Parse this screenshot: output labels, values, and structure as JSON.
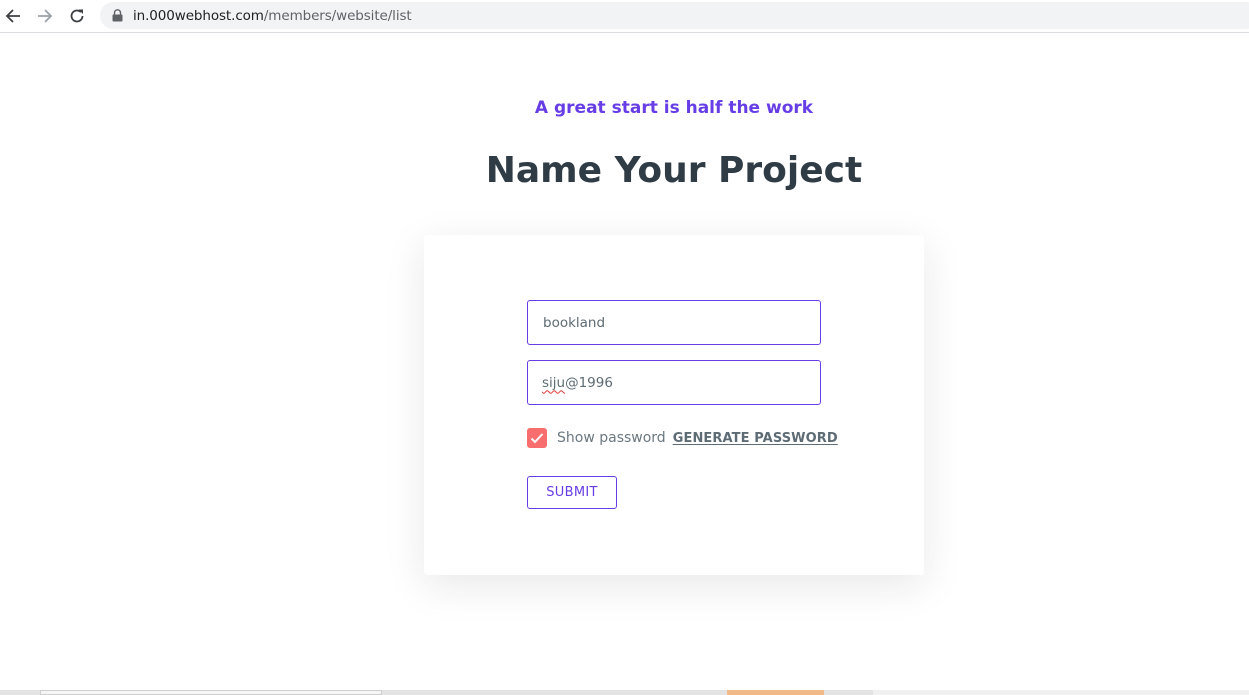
{
  "browser": {
    "url_host": "in.000webhost.com",
    "url_path": "/members/website/list"
  },
  "page": {
    "kicker": "A great start is half the work",
    "title": "Name Your Project"
  },
  "form": {
    "project_name_value": "bookland",
    "password_value_misspelled": "siju",
    "password_value_rest": "@1996",
    "show_password_checked": true,
    "show_password_label": "Show password",
    "generate_password_label": "GENERATE PASSWORD",
    "submit_label": "SUBMIT"
  },
  "colors": {
    "accent": "#673de6",
    "title": "#2f3c45",
    "checkbox": "#f86e6e"
  }
}
